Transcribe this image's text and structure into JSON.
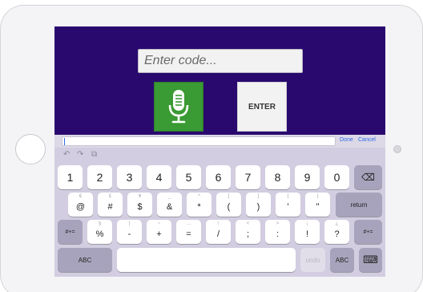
{
  "app": {
    "code_placeholder": "Enter code...",
    "enter_label": "ENTER"
  },
  "accessory": {
    "done_label": "Done",
    "cancel_label": "Cancel"
  },
  "toolbar": {
    "undo_glyph": "↶",
    "redo_glyph": "↷",
    "paste_glyph": "⧉"
  },
  "keyboard": {
    "row1": [
      "1",
      "2",
      "3",
      "4",
      "5",
      "6",
      "7",
      "8",
      "9",
      "0"
    ],
    "row2": [
      {
        "main": "@",
        "hint": "€"
      },
      {
        "main": "#",
        "hint": "£"
      },
      {
        "main": "$",
        "hint": "¥"
      },
      {
        "main": "&",
        "hint": "_"
      },
      {
        "main": "*",
        "hint": "^"
      },
      {
        "main": "(",
        "hint": "["
      },
      {
        "main": ")",
        "hint": "]"
      },
      {
        "main": "'",
        "hint": "{"
      },
      {
        "main": "\"",
        "hint": "}"
      }
    ],
    "row3": [
      {
        "main": "%",
        "hint": "§"
      },
      {
        "main": "-",
        "hint": "|"
      },
      {
        "main": "+",
        "hint": "~"
      },
      {
        "main": "=",
        "hint": "…"
      },
      {
        "main": "/",
        "hint": "\\"
      },
      {
        "main": ";",
        "hint": "<"
      },
      {
        "main": ":",
        "hint": ">"
      },
      {
        "main": "!",
        "hint": "¡"
      },
      {
        "main": "?",
        "hint": "¿"
      }
    ],
    "backspace_glyph": "⌫",
    "return_label": "return",
    "shift_symbols_label": "#+=",
    "abc_label": "ABC",
    "undo_label": "undo",
    "hide_keyboard_glyph": "⌨"
  },
  "colors": {
    "app_background": "#2a096f",
    "mic_green": "#3a9a33",
    "link_blue": "#2f6be6",
    "keyboard_background": "#d2cde0"
  }
}
